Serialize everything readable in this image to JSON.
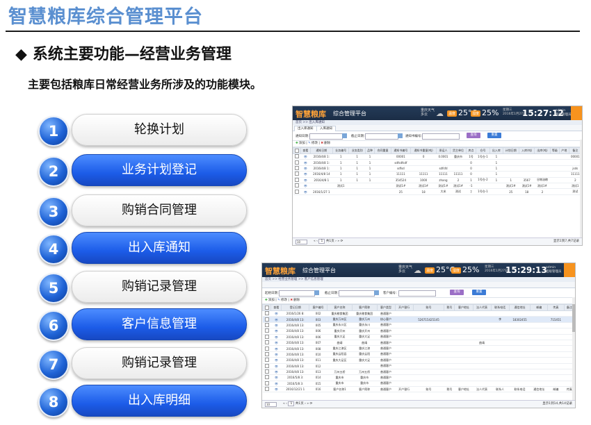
{
  "slide": {
    "title": "智慧粮库综合管理平台",
    "heading_marker": "◆",
    "heading": "系统主要功能—经营业务管理",
    "subtitle": "主要包括粮库日常经营业务所涉及的功能模块。"
  },
  "menu": [
    {
      "num": "1",
      "label": "轮换计划",
      "style": "white"
    },
    {
      "num": "2",
      "label": "业务计划登记",
      "style": "blue"
    },
    {
      "num": "3",
      "label": "购销合同管理",
      "style": "white"
    },
    {
      "num": "4",
      "label": "出入库通知",
      "style": "blue"
    },
    {
      "num": "5",
      "label": "购销记录管理",
      "style": "white"
    },
    {
      "num": "6",
      "label": "客户信息管理",
      "style": "blue"
    },
    {
      "num": "7",
      "label": "购销记录管理",
      "style": "white"
    },
    {
      "num": "8",
      "label": "出入库明细",
      "style": "blue"
    }
  ],
  "shot1": {
    "logo": "智慧粮库",
    "app_title": "综合管理平台",
    "weather_label": "重庆天气",
    "weather_sub": "多云",
    "temp_badge": "温度",
    "temp": "25°C",
    "humid_badge": "湿度",
    "humid": "25%",
    "clock": "15:27:12",
    "date_line1": "星期三",
    "date_line2": "2016年1月27日",
    "user_line1": "admin",
    "user_line2": "超级管理员",
    "crumb": "首页 >> 出入库通知",
    "tabs": [
      "出入库通知",
      "入库通知"
    ],
    "filters": {
      "label1": "通知日期：",
      "label2": "截止日期：",
      "label3": "通知书编号：",
      "query": "查询",
      "reset": "重置"
    },
    "toolbar": {
      "add": "添加",
      "edit": "修改",
      "del": "删除"
    },
    "columns": [
      "",
      "查看",
      "通知日期",
      "业务编号",
      "业务类别",
      "品种",
      "合同重量",
      "通知书编号",
      "通知书重量(吨)",
      "承运人",
      "货主单位",
      "库点",
      "仓号",
      "出入库",
      "计划日期",
      "入库(吨)",
      "出库(吨)",
      "等级",
      "产地",
      "备注"
    ],
    "rows": [
      [
        "",
        "",
        "2016/4/8 1:",
        "1",
        "1",
        "1",
        "",
        "00001",
        "0",
        "0.0001",
        "重庆市",
        "1号",
        "1号仓-1",
        "1",
        "",
        "",
        "",
        "",
        "",
        "00001"
      ],
      [
        "",
        "",
        "2016/4/8 1:",
        "1",
        "1",
        "1",
        "",
        "sdfsdfsdf",
        "",
        "",
        "",
        "0",
        "",
        "1",
        "",
        "",
        "",
        "",
        "",
        ""
      ],
      [
        "",
        "",
        "2016/4/8 1:",
        "1",
        "1",
        "1",
        "",
        "sdfsd",
        "",
        "sdfsfd",
        "",
        "0",
        "",
        "1",
        "",
        "",
        "",
        "",
        "",
        "jsds"
      ],
      [
        "",
        "",
        "2016/4/8 14",
        "1",
        "1",
        "1",
        "",
        "11111",
        "11111",
        "11111",
        "11111",
        "0",
        "",
        "1",
        "",
        "",
        "",
        "",
        "",
        "11111"
      ],
      [
        "",
        "",
        "2016/4/8 1",
        "1",
        "1",
        "1",
        "",
        "354524",
        "1000",
        "zhang",
        "2",
        "1",
        "1号仓-2",
        "1",
        "1",
        "3567",
        "谷物油粮",
        "",
        "",
        "2"
      ],
      [
        "",
        "",
        "",
        "测试1",
        "",
        "",
        "",
        "测试1#",
        "测试1#",
        "测试1#",
        "测试1#",
        "-1",
        "",
        "",
        "测试1#",
        "测试1#",
        "测试1#",
        "",
        "",
        "测试1"
      ],
      [
        "",
        "",
        "2016/1/27 1",
        "",
        "",
        "",
        "",
        "25",
        "18",
        "大米",
        "测试",
        "7",
        "1号仓-1",
        "",
        "25",
        "18",
        "2",
        "",
        "",
        "测试"
      ]
    ],
    "pager": {
      "size": "10",
      "page": "1",
      "of": "共1页",
      "info": "显示1到7,共7记录"
    }
  },
  "shot2": {
    "logo": "智慧粮库",
    "app_title": "综合管理平台",
    "weather_label": "重庆天气",
    "weather_sub": "多云",
    "temp_badge": "温度",
    "temp": "25°C",
    "humid_badge": "湿度",
    "humid": "25%",
    "clock": "15:29:13",
    "date_line1": "星期三",
    "date_line2": "2016年1月27日",
    "user_line1": "admin",
    "user_line2": "超级管理员",
    "crumb": "首页 >> 经营业务管理 >> 客户信息管理",
    "filters": {
      "label1": "起始日期：",
      "label2": "截止日期：",
      "label3": "客户编号：",
      "query": "查询",
      "reset": "重置"
    },
    "toolbar": {
      "add": "添加",
      "edit": "修改",
      "del": "删除"
    },
    "columns": [
      "",
      "查看",
      "登记日期",
      "客户编号",
      "客户名称",
      "客户简称",
      "客户类型",
      "开户银行",
      "账号",
      "税号",
      "客户地址",
      "法人代表",
      "联系电话",
      "通信地址",
      "邮编",
      "传真",
      "备注"
    ],
    "rows": [
      [
        "",
        "",
        "2016/1/26 8:",
        "002",
        "重庆粮食集团",
        "重庆粮食集团",
        "普通客户",
        "",
        "",
        "",
        "",
        "",
        "",
        "",
        "",
        "",
        ""
      ],
      [
        "",
        "",
        "2016/4/8 13:",
        "003",
        "重庆万州区",
        "重庆万州",
        "核心客户",
        "",
        "526715425145",
        "",
        "",
        "",
        "李",
        "18302455",
        "",
        "715451",
        ""
      ],
      [
        "",
        "",
        "2016/4/8 13:",
        "005",
        "重庆永川区",
        "重庆永川",
        "普通客户",
        "",
        "",
        "",
        "",
        "",
        "",
        "",
        "",
        "",
        ""
      ],
      [
        "",
        "",
        "2016/4/8 13:",
        "006",
        "重庆开州",
        "重庆开州",
        "普通客户",
        "",
        "",
        "",
        "",
        "",
        "",
        "",
        "",
        "",
        ""
      ],
      [
        "",
        "",
        "2016/4/8 13:",
        "006",
        "重庆大足",
        "重庆大足",
        "普通客户",
        "",
        "",
        "",
        "",
        "",
        "",
        "",
        "",
        "",
        ""
      ],
      [
        "",
        "",
        "2016/4/8 13:",
        "007",
        "曲靖",
        "曲靖",
        "普通客户",
        "",
        "",
        "",
        "",
        "曲靖",
        "",
        "",
        "",
        "",
        ""
      ],
      [
        "",
        "",
        "2016/4/8 13:",
        "008",
        "重庆江津区",
        "重庆江津",
        "普通客户",
        "",
        "",
        "",
        "",
        "",
        "",
        "",
        "",
        "",
        ""
      ],
      [
        "",
        "",
        "2016/4/8 13:",
        "010",
        "重庆云阳县",
        "重庆云阳",
        "普通客户",
        "",
        "",
        "",
        "",
        "",
        "",
        "",
        "",
        "",
        ""
      ],
      [
        "",
        "",
        "2016/4/8 13:",
        "011",
        "重庆大足区",
        "重庆大足",
        "普通客户",
        "",
        "",
        "",
        "",
        "",
        "",
        "",
        "",
        "",
        ""
      ],
      [
        "",
        "",
        "2016/4/8 13:",
        "012",
        "",
        "",
        "普通客户",
        "",
        "",
        "",
        "",
        "",
        "",
        "",
        "",
        "",
        ""
      ],
      [
        "",
        "",
        "2016/4/8 13:",
        "013",
        "万州五桥",
        "万州五桥",
        "普通客户",
        "",
        "",
        "",
        "",
        "",
        "",
        "",
        "",
        "",
        ""
      ],
      [
        "",
        "",
        "2016/5/8 3:",
        "014",
        "重庆市",
        "重庆市",
        "普通客户",
        "",
        "",
        "",
        "",
        "",
        "",
        "",
        "",
        "",
        ""
      ],
      [
        "",
        "",
        "2016/5/8 3:",
        "015",
        "重庆市",
        "重庆市",
        "普通客户",
        "",
        "",
        "",
        "",
        "",
        "",
        "",
        "",
        "",
        ""
      ],
      [
        "",
        "",
        "2016/12/21 1",
        "016",
        "客户名称1",
        "客户简称",
        "普通客户",
        "开户银行",
        "账号",
        "税号",
        "客户地址",
        "法人代表",
        "联系人",
        "联系电话",
        "通信地址",
        "邮编",
        "传真"
      ]
    ],
    "pager": {
      "size": "10",
      "page": "1",
      "of": "共1页",
      "info": "显示1到14,共14记录"
    }
  },
  "colors": {
    "accent_blue": "#1c5ce8",
    "title_blue": "#5a8fd0",
    "orange": "#f7931e",
    "header_dark": "#1b2d46"
  }
}
